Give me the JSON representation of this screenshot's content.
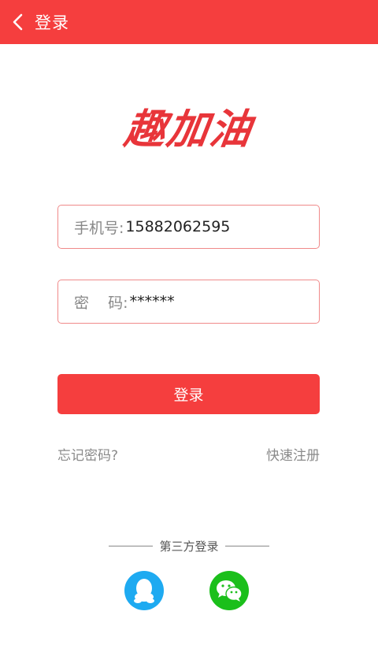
{
  "header": {
    "title": "登录",
    "bg_color": "#f53e3e",
    "back_icon": "chevron-left-icon"
  },
  "logo": {
    "text": "趣加油",
    "color": "#e8353a"
  },
  "form": {
    "phone": {
      "label": "手机号:",
      "value": "15882062595"
    },
    "password": {
      "label": "密    码:",
      "value": "******"
    },
    "submit_label": "登录"
  },
  "links": {
    "forgot": "忘记密码?",
    "register": "快速注册"
  },
  "third_party": {
    "title": "第三方登录",
    "providers": [
      {
        "icon": "qq-icon",
        "color": "#1eaaf1"
      },
      {
        "icon": "wechat-icon",
        "color": "#1bbf1b"
      }
    ]
  }
}
